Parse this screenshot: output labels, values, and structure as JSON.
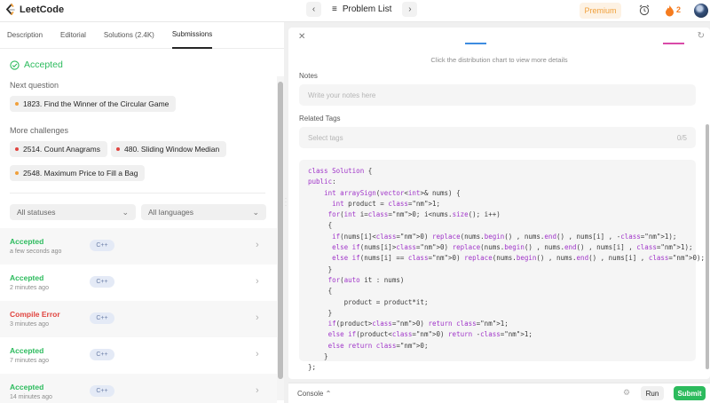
{
  "app": {
    "name": "LeetCode"
  },
  "topbar": {
    "problem_list_label": "Problem List",
    "premium_label": "Premium",
    "streak_count": "2",
    "accent_orange": "#f57c1f"
  },
  "tabs": [
    {
      "label": "Description"
    },
    {
      "label": "Editorial"
    },
    {
      "label": "Solutions (2.4K)"
    },
    {
      "label": "Submissions"
    }
  ],
  "result": {
    "status": "Accepted",
    "next_question_label": "Next question",
    "next_question": "1823. Find the Winner of the Circular Game",
    "more_challenges_label": "More challenges",
    "challenges": [
      {
        "label": "2514. Count Anagrams",
        "difficulty_color": "#e0443f"
      },
      {
        "label": "480. Sliding Window Median",
        "difficulty_color": "#e0443f"
      },
      {
        "label": "2548. Maximum Price to Fill a Bag",
        "difficulty_color": "#f0a03c"
      }
    ]
  },
  "filters": {
    "status_select": "All statuses",
    "language_select": "All languages"
  },
  "submissions": [
    {
      "status": "Accepted",
      "time": "a few seconds ago",
      "lang": "C++",
      "color": "#2cbb5d"
    },
    {
      "status": "Accepted",
      "time": "2 minutes ago",
      "lang": "C++",
      "color": "#2cbb5d"
    },
    {
      "status": "Compile Error",
      "time": "3 minutes ago",
      "lang": "C++",
      "color": "#e0443f"
    },
    {
      "status": "Accepted",
      "time": "7 minutes ago",
      "lang": "C++",
      "color": "#2cbb5d"
    },
    {
      "status": "Accepted",
      "time": "14 minutes ago",
      "lang": "C++",
      "color": "#2cbb5d"
    }
  ],
  "detail": {
    "hint": "Click the distribution chart to view more details",
    "notes_label": "Notes",
    "notes_placeholder": "Write your notes here",
    "tags_label": "Related Tags",
    "tags_placeholder": "Select tags",
    "tags_count": "0/5"
  },
  "code": [
    "class Solution {",
    "public:",
    "    int arraySign(vector<int>& nums) {",
    "      int product = 1;",
    "     for(int i=0; i<nums.size(); i++)",
    "     {",
    "      if(nums[i]<0) replace(nums.begin() , nums.end() , nums[i] , -1);",
    "      else if(nums[i]>0) replace(nums.begin() , nums.end() , nums[i] , 1);",
    "      else if(nums[i] == 0) replace(nums.begin() , nums.end() , nums[i] , 0);",
    "     }",
    "     for(auto it : nums)",
    "     {",
    "         product = product*it;",
    "     }",
    "     if(product>0) return 1;",
    "     else if(product<0) return -1;",
    "     else return 0;",
    "    }",
    "};"
  ],
  "console": {
    "label": "Console",
    "run_label": "Run",
    "submit_label": "Submit"
  }
}
